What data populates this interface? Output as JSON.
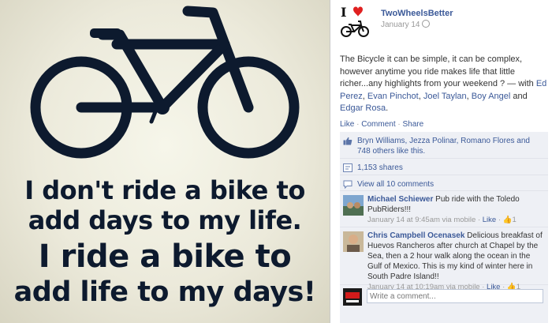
{
  "poster": {
    "lines": [
      "I don't ride a bike to",
      "add days to my life.",
      "I ride a bike to",
      "add life to my days!"
    ]
  },
  "post": {
    "page_name": "TwoWheelsBetter",
    "date": "January 14",
    "text_intro": "The Bicycle it can be simple, it can be complex, however anytime you ride makes life that little richer...any highlights from your weekend ? — with ",
    "tagged": [
      "Ed Perez",
      "Evan Pinchot",
      "Joel Taylan",
      "Boy Angel",
      "Edgar Rosa"
    ],
    "sep_comma": ", ",
    "sep_and": " and ",
    "text_end": ".",
    "actions": {
      "like": "Like",
      "comment": "Comment",
      "share": "Share",
      "sep": " · "
    }
  },
  "ufi": {
    "likes_text": "Bryn Williams, Jezza Polinar, Romano Flores and 748 others like this.",
    "shares_text": "1,153 shares",
    "view_all": "View all 10 comments",
    "comments": [
      {
        "author": "Michael Schiewer",
        "text": " Pub ride with the Toledo PubRiders!!!",
        "meta": "January 14 at 9:45am via mobile · ",
        "like": "Like",
        "like_count": " · 👍1"
      },
      {
        "author": "Chris Campbell Ocenasek",
        "text": " Delicious breakfast of Huevos Rancheros after church at Chapel by the Sea, then a 2 hour walk along the ocean in the Gulf of Mexico. This is my kind of winter here in South Padre Island!!",
        "meta": "January 14 at 10:19am via mobile · ",
        "like": "Like",
        "like_count": " · 👍1"
      }
    ],
    "write_placeholder": "Write a comment..."
  },
  "colors": {
    "link": "#3b5998",
    "ufi_bg": "#eef0f5",
    "poster_ink": "#0d1a2e",
    "heart": "#e02020"
  },
  "icons": [
    "bicycle-icon",
    "heart-icon",
    "globe-icon",
    "like-thumb-icon",
    "share-icon",
    "comments-icon"
  ]
}
